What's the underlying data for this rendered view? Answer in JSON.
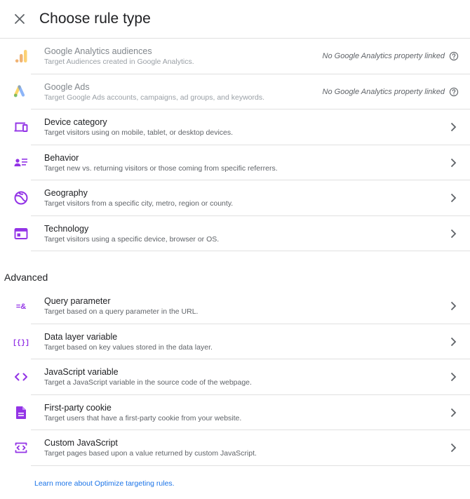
{
  "header": {
    "title": "Choose rule type",
    "close_icon": "close-icon"
  },
  "colors": {
    "accent_purple": "#9334e6",
    "link_blue": "#1a73e8",
    "ga_orange": "#f9ab00",
    "ads_blue": "#4285f4",
    "ads_yellow": "#fbbc04",
    "ads_green": "#34a853"
  },
  "rules": {
    "google_analytics": {
      "title": "Google Analytics audiences",
      "subtitle": "Target Audiences created in Google Analytics.",
      "status": "No Google Analytics property linked",
      "icon": "google-analytics-icon"
    },
    "google_ads": {
      "title": "Google Ads",
      "subtitle": "Target Google Ads accounts, campaigns, ad groups, and keywords.",
      "status": "No Google Analytics property linked",
      "icon": "google-ads-icon"
    },
    "device_category": {
      "title": "Device category",
      "subtitle": "Target visitors using on mobile, tablet, or desktop devices.",
      "icon": "devices-icon"
    },
    "behavior": {
      "title": "Behavior",
      "subtitle": "Target new vs. returning visitors or those coming from specific referrers.",
      "icon": "behavior-icon"
    },
    "geography": {
      "title": "Geography",
      "subtitle": "Target visitors from a specific city, metro, region or county.",
      "icon": "globe-icon"
    },
    "technology": {
      "title": "Technology",
      "subtitle": "Target visitors using a specific device, browser or OS.",
      "icon": "browser-window-icon"
    }
  },
  "advanced": {
    "title": "Advanced",
    "query_parameter": {
      "title": "Query parameter",
      "subtitle": "Target based on a query parameter in the URL.",
      "icon_text": "=&"
    },
    "data_layer_variable": {
      "title": "Data layer variable",
      "subtitle": "Target based on key values stored in the data layer.",
      "icon_text": "[{}]"
    },
    "javascript_variable": {
      "title": "JavaScript variable",
      "subtitle": "Target a JavaScript variable in the source code of the webpage.",
      "icon": "code-icon"
    },
    "first_party_cookie": {
      "title": "First-party cookie",
      "subtitle": "Target users that have a first-party cookie from your website.",
      "icon": "document-icon"
    },
    "custom_javascript": {
      "title": "Custom JavaScript",
      "subtitle": "Target pages based upon a value returned by custom JavaScript.",
      "icon": "code-window-icon"
    }
  },
  "footer": {
    "learn_more": "Learn more about Optimize targeting rules."
  }
}
